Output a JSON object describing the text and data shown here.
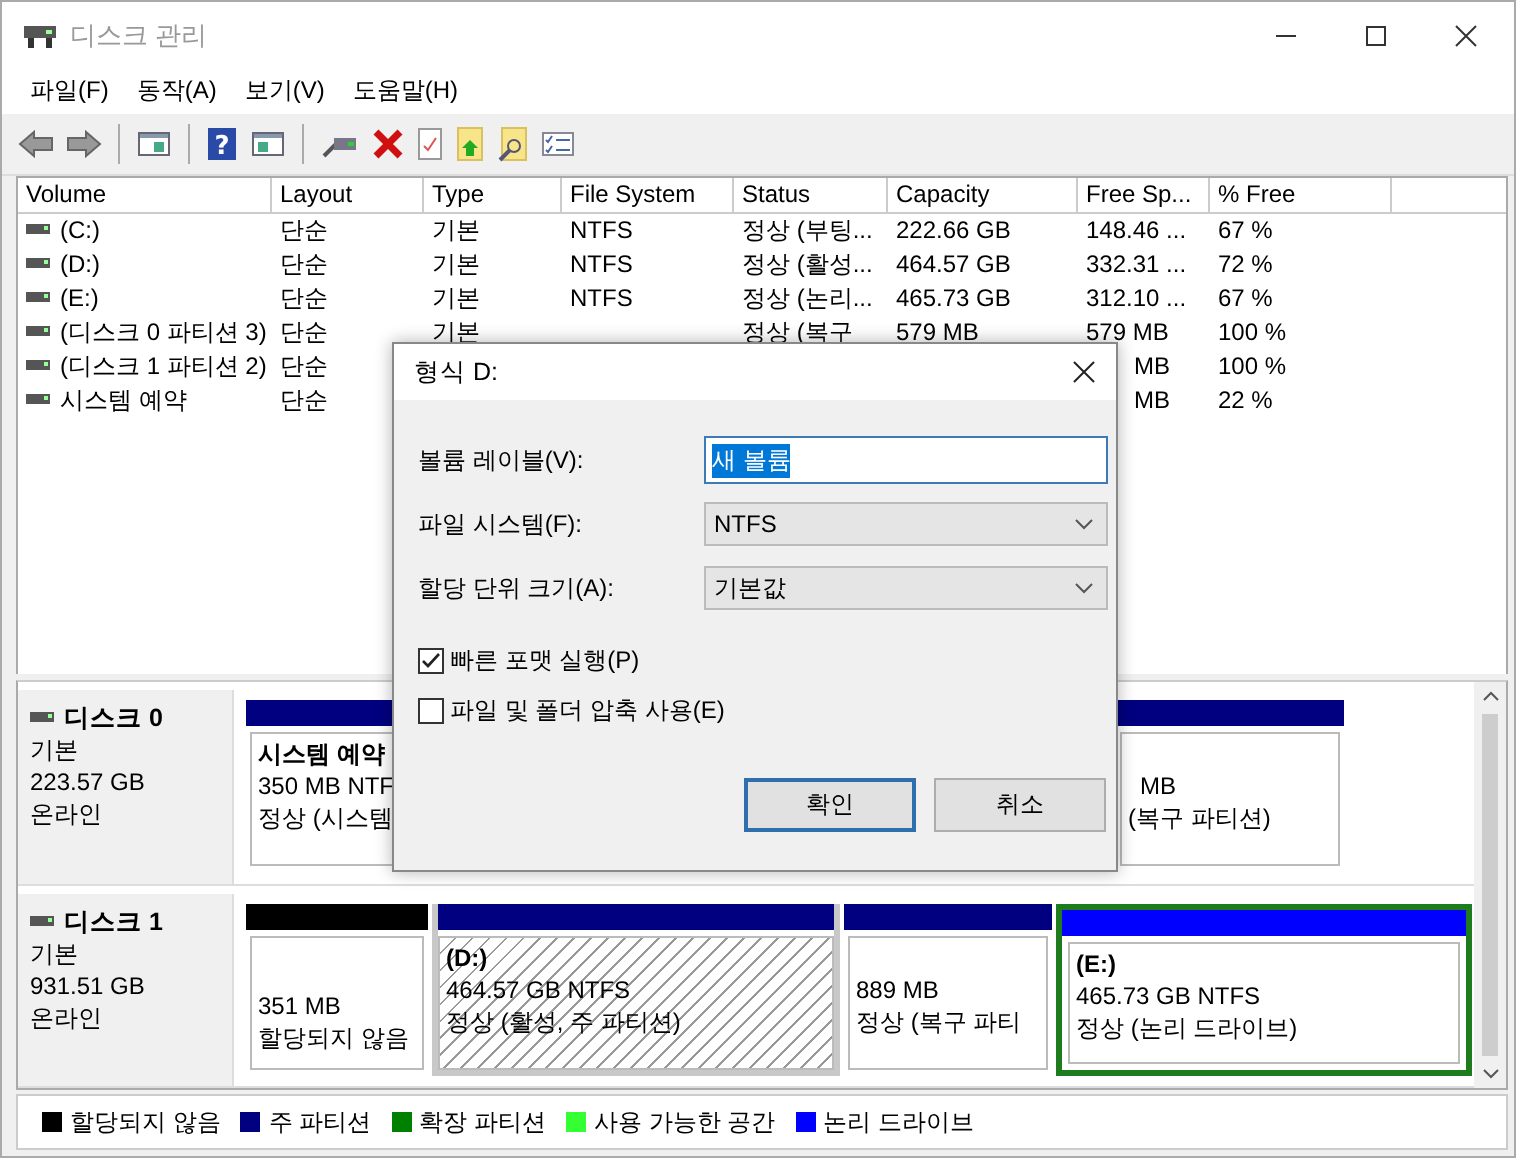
{
  "window": {
    "title": "디스크 관리"
  },
  "menu": [
    "파일(F)",
    "동작(A)",
    "보기(V)",
    "도움말(H)"
  ],
  "toolbar": {
    "help_glyph": "?"
  },
  "volume_table": {
    "columns": [
      "Volume",
      "Layout",
      "Type",
      "File System",
      "Status",
      "Capacity",
      "Free Sp...",
      "% Free"
    ],
    "rows": [
      {
        "volume": "(C:)",
        "layout": "단순",
        "type": "기본",
        "file_system": "NTFS",
        "status": "정상 (부팅...",
        "capacity": "222.66 GB",
        "free_space": "148.46 ...",
        "percent_free": "67 %",
        "covered": false
      },
      {
        "volume": "(D:)",
        "layout": "단순",
        "type": "기본",
        "file_system": "NTFS",
        "status": "정상 (활성...",
        "capacity": "464.57 GB",
        "free_space": "332.31 ...",
        "percent_free": "72 %",
        "covered": false
      },
      {
        "volume": "(E:)",
        "layout": "단순",
        "type": "기본",
        "file_system": "NTFS",
        "status": "정상 (논리...",
        "capacity": "465.73 GB",
        "free_space": "312.10 ...",
        "percent_free": "67 %",
        "covered": false
      },
      {
        "volume": "(디스크 0 파티션 3)",
        "layout": "단순",
        "type": "기본",
        "status": "정상 (복구",
        "capacity": "579 MB",
        "free_space": "579 MB",
        "percent_free": "100 %",
        "covered": false
      },
      {
        "volume": "(디스크 1 파티션 2)",
        "layout": "단순",
        "free_space": "MB",
        "percent_free": "100 %",
        "covered": true
      },
      {
        "volume": "시스템 예약",
        "layout": "단순",
        "free_space": "MB",
        "percent_free": "22 %",
        "covered": true
      }
    ]
  },
  "disks": [
    {
      "name": "디스크 0",
      "type": "기본",
      "size": "223.57 GB",
      "status": "온라인",
      "partitions": [
        {
          "kind": "primary",
          "title": "시스템 예약",
          "size": "350 MB NTF",
          "status": "정상 (시스템",
          "selected": false
        },
        {
          "kind": "primary",
          "size": "MB",
          "status": "(복구 파티션)",
          "selected": false
        }
      ]
    },
    {
      "name": "디스크 1",
      "type": "기본",
      "size": "931.51 GB",
      "status": "온라인",
      "partitions": [
        {
          "kind": "unallocated",
          "size": "351 MB",
          "status": "할당되지 않음",
          "selected": false
        },
        {
          "kind": "primary",
          "title": "(D:)",
          "size": "464.57 GB NTFS",
          "status": "정상 (활성, 주 파티션)",
          "selected": true
        },
        {
          "kind": "primary",
          "size": "889 MB",
          "status": "정상 (복구 파티",
          "selected": false
        },
        {
          "kind": "logical",
          "title": "(E:)",
          "size": "465.73 GB NTFS",
          "status": "정상 (논리 드라이브)",
          "selected": false
        }
      ]
    }
  ],
  "legend": [
    {
      "color": "#000000",
      "label": "할당되지 않음"
    },
    {
      "color": "#000080",
      "label": "주 파티션"
    },
    {
      "color": "#008000",
      "label": "확장 파티션"
    },
    {
      "color": "#33ff33",
      "label": "사용 가능한 공간"
    },
    {
      "color": "#0000ff",
      "label": "논리 드라이브"
    }
  ],
  "dialog": {
    "title": "형식 D:",
    "fields": [
      {
        "kind": "text",
        "label": "볼륨 레이블(V):",
        "value": "새 볼륨",
        "selected": true
      },
      {
        "kind": "select",
        "label": "파일 시스템(F):",
        "value": "NTFS"
      },
      {
        "kind": "select",
        "label": "할당 단위 크기(A):",
        "value": "기본값"
      }
    ],
    "checkboxes": [
      {
        "label": "빠른 포맷 실행(P)",
        "checked": true
      },
      {
        "label": "파일 및 폴더 압축 사용(E)",
        "checked": false
      }
    ],
    "buttons": [
      {
        "label": "확인",
        "default": true
      },
      {
        "label": "취소",
        "default": false
      }
    ]
  }
}
